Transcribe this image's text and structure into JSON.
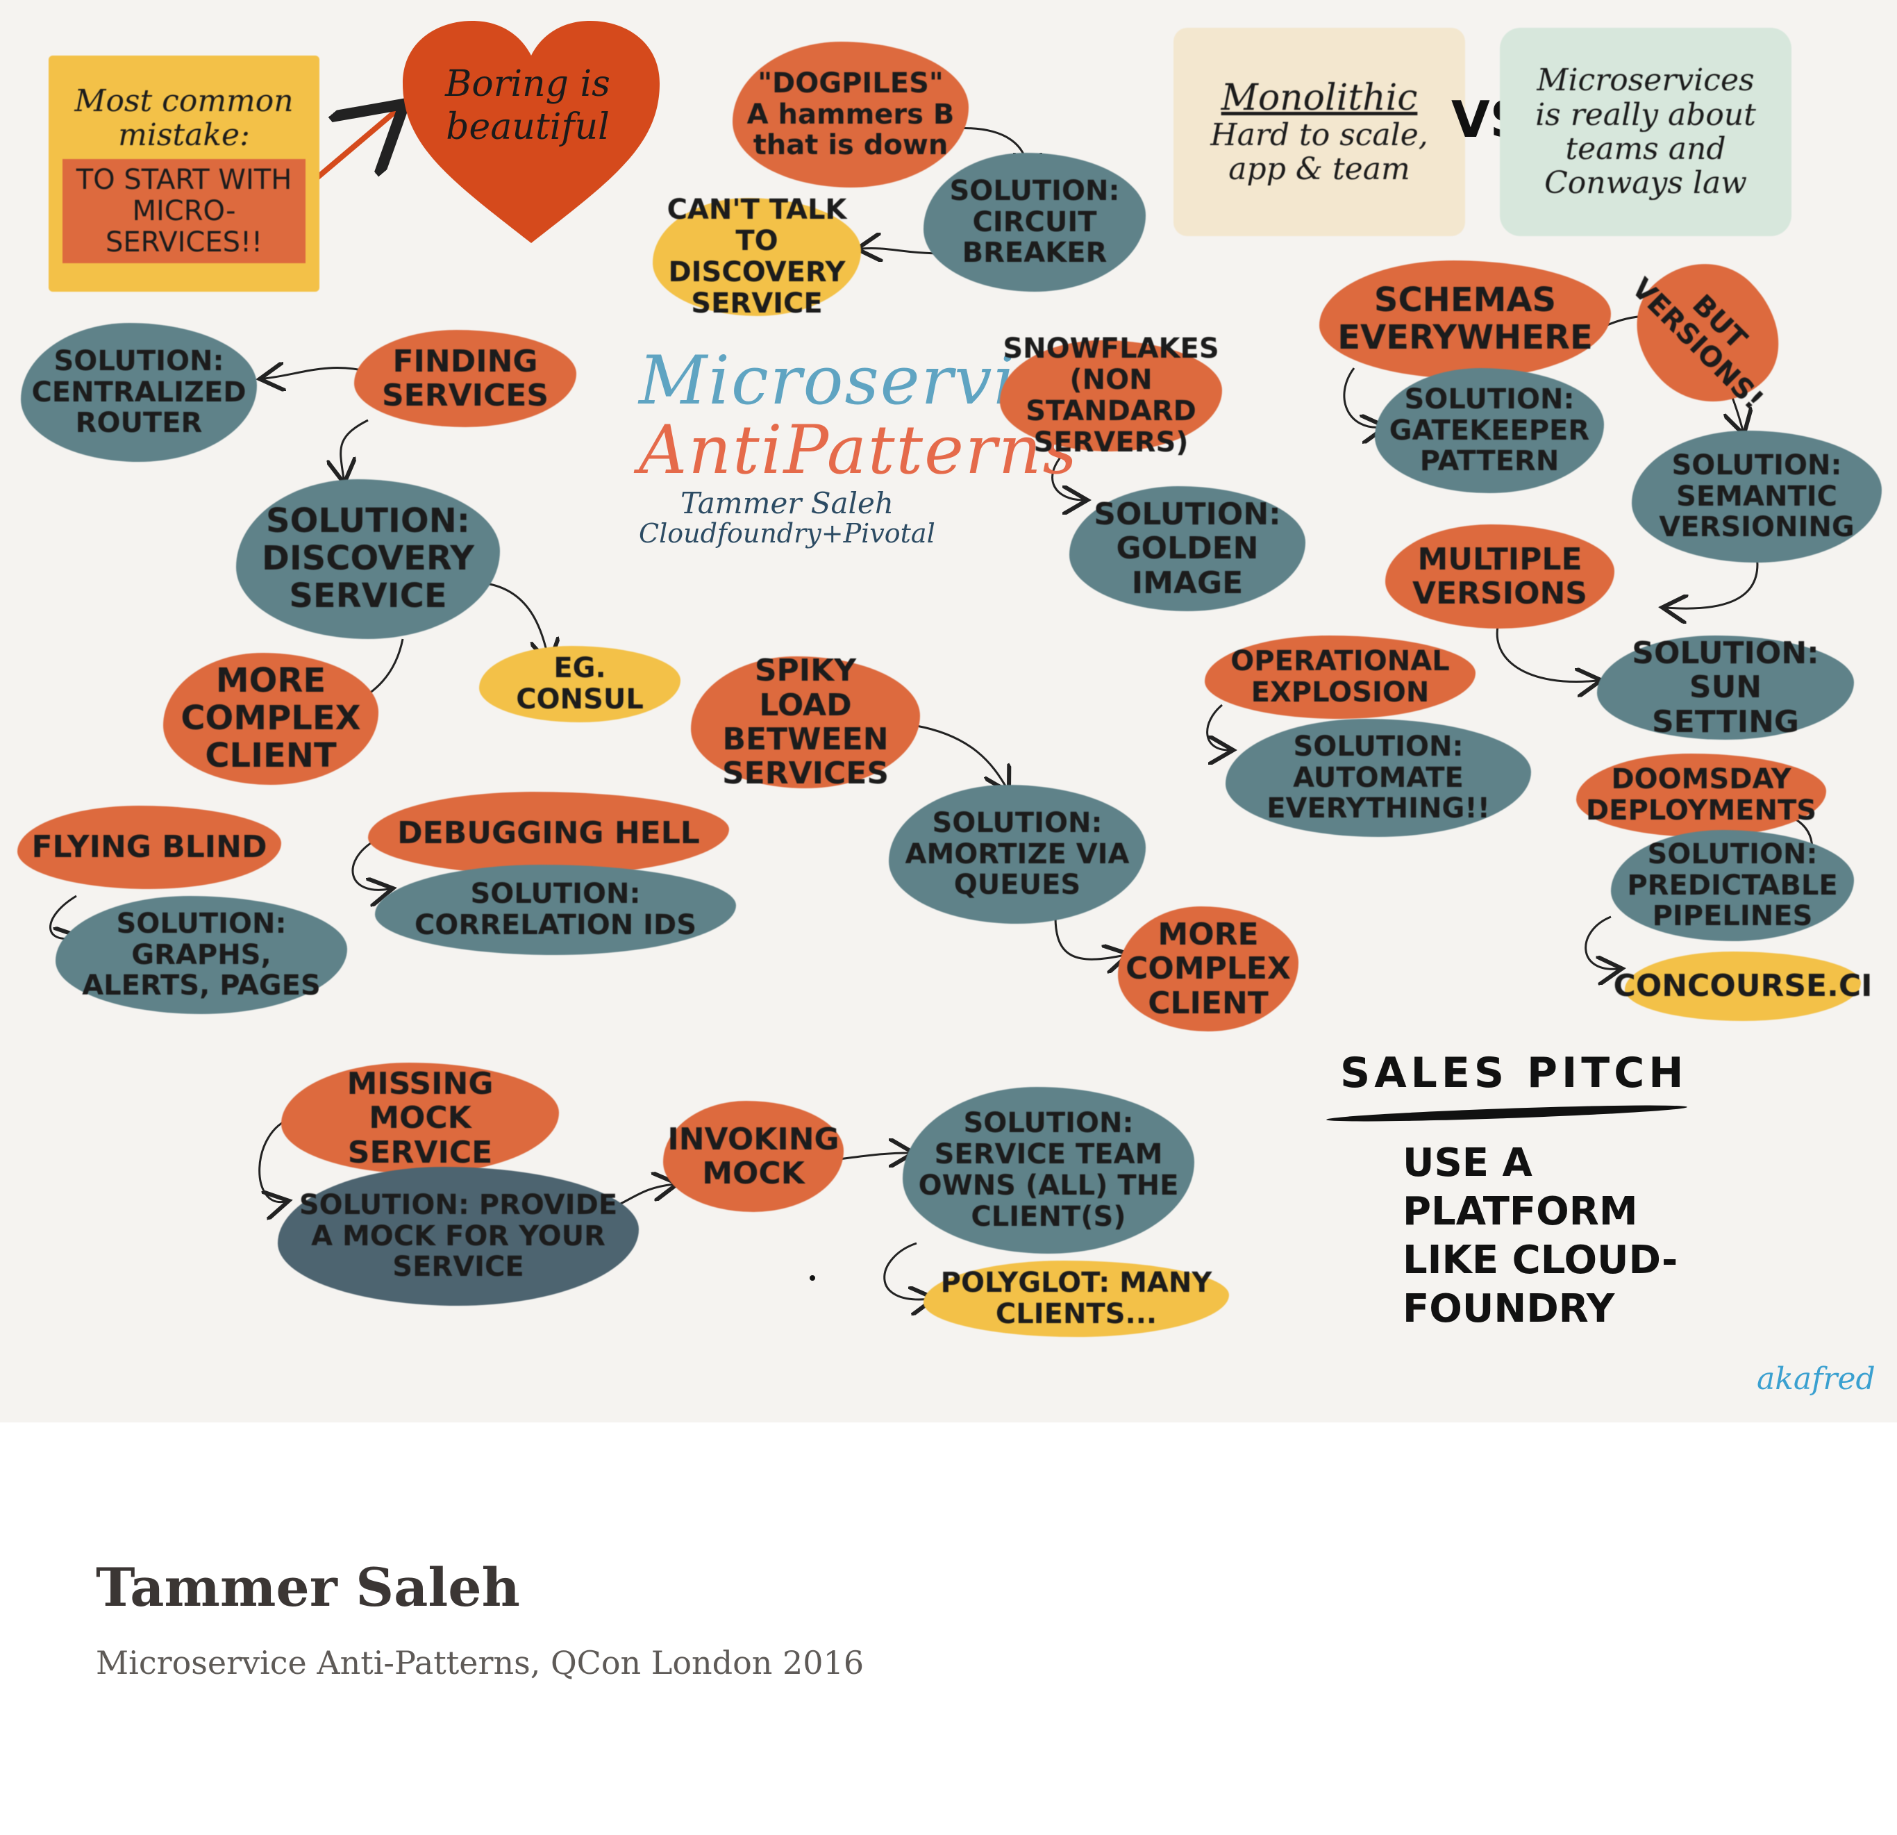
{
  "sketch": {
    "title": {
      "line1": "Microservice",
      "line2": "AntiPatterns",
      "speaker": "Tammer Saleh",
      "company": "Cloudfoundry+Pivotal"
    },
    "notes": {
      "most_common_mistake": {
        "label": "Most common mistake:",
        "highlight": "TO START WITH MICRO-SERVICES!!"
      },
      "boring": "Boring is beautiful",
      "dogpiles": "\"DOGPILES\" A hammers B that is down",
      "circuit_breaker": "SOLUTION: CIRCUIT BREAKER",
      "cant_talk": "CAN'T TALK TO DISCOVERY SERVICE",
      "monolithic": {
        "title": "Monolithic",
        "text": "Hard to scale, app & team"
      },
      "vs": "VS",
      "microservices": {
        "title": "Microservices",
        "text": "is really about teams and Conways law"
      },
      "finding_services": "FINDING SERVICES",
      "centralized_router": "SOLUTION: CENTRALIZED ROUTER",
      "discovery_service": "SOLUTION: DISCOVERY SERVICE",
      "consul": "EG. CONSUL",
      "more_complex_client_1": "MORE COMPLEX CLIENT",
      "flying_blind": "FLYING BLIND",
      "graphs_alerts": "SOLUTION: GRAPHS, ALERTS, PAGES",
      "debugging_hell": "DEBUGGING HELL",
      "correlation_ids": "SOLUTION: CORRELATION IDS",
      "spiky_load": "SPIKY LOAD BETWEEN SERVICES",
      "amortize": "SOLUTION: AMORTIZE VIA QUEUES",
      "more_complex_client_2": "MORE COMPLEX CLIENT",
      "snowflakes": "SNOWFLAKES (NON STANDARD SERVERS)",
      "golden_image": "SOLUTION: GOLDEN IMAGE",
      "schemas": "SCHEMAS EVERYWHERE",
      "but_versions": "BUT VERSIONS!",
      "gatekeeper": "SOLUTION: GATEKEEPER PATTERN",
      "semantic_versioning": "SOLUTION: SEMANTIC VERSIONING",
      "multiple_versions": "MULTIPLE VERSIONS",
      "sun_setting": "SOLUTION: SUN SETTING",
      "operational_explosion": "OPERATIONAL EXPLOSION",
      "automate": "SOLUTION: AUTOMATE EVERYTHING!!",
      "doomsday": "DOOMSDAY DEPLOYMENTS",
      "pipelines": "SOLUTION: PREDICTABLE PIPELINES",
      "concourse": "CONCOURSE.CI",
      "missing_mock": "MISSING MOCK SERVICE",
      "provide_mock": "SOLUTION: PROVIDE A MOCK FOR YOUR SERVICE",
      "invoking_mock": "INVOKING MOCK",
      "service_team": "SOLUTION: SERVICE TEAM OWNS (ALL) THE CLIENT(S)",
      "polyglot": "POLYGLOT: MANY CLIENTS..."
    },
    "sales_pitch": {
      "heading": "SALES PITCH",
      "text": "USE A PLATFORM LIKE CLOUD-FOUNDRY"
    },
    "signature": "akafred"
  },
  "caption": {
    "name": "Tammer Saleh",
    "subtitle": "Microservice Anti-Patterns, QCon London 2016"
  },
  "colors": {
    "orange": "#dd6a3e",
    "teal": "#5f8289",
    "yellow": "#f3c148",
    "red": "#d54a1c",
    "title_blue": "#5fa4c2",
    "title_orange": "#e56a4a"
  }
}
